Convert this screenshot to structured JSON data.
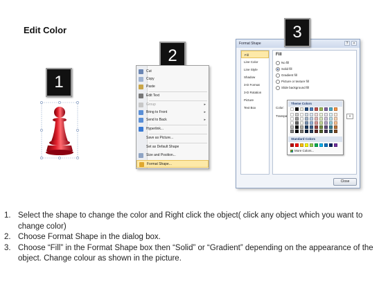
{
  "title": "Edit Color",
  "step_badges": [
    "1",
    "2",
    "3"
  ],
  "context_menu": {
    "items": [
      {
        "label": "Cut",
        "icon": "scissors-icon",
        "dim": false,
        "submenu": false
      },
      {
        "label": "Copy",
        "icon": "copy-icon",
        "dim": false,
        "submenu": false
      },
      {
        "label": "Paste",
        "icon": "paste-icon",
        "dim": false,
        "submenu": false
      },
      {
        "label": "Edit Text",
        "icon": "edit-text-icon",
        "dim": false,
        "submenu": false
      },
      {
        "label": "Group",
        "icon": "group-icon",
        "dim": true,
        "submenu": true
      },
      {
        "label": "Bring to Front",
        "icon": "bring-front-icon",
        "dim": false,
        "submenu": true
      },
      {
        "label": "Send to Back",
        "icon": "send-back-icon",
        "dim": false,
        "submenu": true
      },
      {
        "label": "Hyperlink...",
        "icon": "hyperlink-icon",
        "dim": false,
        "submenu": false
      },
      {
        "label": "Save as Picture...",
        "icon": "",
        "dim": false,
        "submenu": false
      },
      {
        "label": "Set as Default Shape",
        "icon": "",
        "dim": false,
        "submenu": false
      },
      {
        "label": "Size and Position...",
        "icon": "size-icon",
        "dim": false,
        "submenu": false
      },
      {
        "label": "Format Shape...",
        "icon": "format-shape-icon",
        "dim": false,
        "submenu": false,
        "highlighted": true
      }
    ]
  },
  "dialog": {
    "title": "Format Shape",
    "help": "?",
    "close_x": "×",
    "nav": [
      "Fill",
      "Line Color",
      "Line Style",
      "Shadow",
      "3-D Format",
      "3-D Rotation",
      "Picture",
      "Text Box"
    ],
    "fill_heading": "Fill",
    "options": [
      {
        "label": "No fill",
        "selected": false
      },
      {
        "label": "Solid fill",
        "selected": true
      },
      {
        "label": "Gradient fill",
        "selected": false
      },
      {
        "label": "Picture or texture fill",
        "selected": false
      },
      {
        "label": "Slide background fill",
        "selected": false
      }
    ],
    "color_label": "Color:",
    "transparency_label": "Transparency:",
    "close_button": "Close",
    "accent_color": "#c00000"
  },
  "palette": {
    "theme_heading": "Theme Colors",
    "standard_heading": "Standard Colors",
    "more_colors": "More Colors...",
    "theme_top": [
      "#ffffff",
      "#000000",
      "#eeece1",
      "#1f497d",
      "#4f81bd",
      "#c0504d",
      "#9bbb59",
      "#8064a2",
      "#4bacc6",
      "#f79646"
    ],
    "standard": [
      "#c00000",
      "#ff0000",
      "#ffc000",
      "#ffff00",
      "#92d050",
      "#00b050",
      "#00b0f0",
      "#0070c0",
      "#002060",
      "#7030a0"
    ]
  },
  "instructions": [
    {
      "num": "1.",
      "text": "Select the shape to change the color and Right click the object( click any object which you want to change color)"
    },
    {
      "num": "2.",
      "text": "Choose Format Shape in the dialog box."
    },
    {
      "num": "3.",
      "text": "Choose “Fill” in the Format Shape box then “Solid” or “Gradient” depending on the appearance of the object. Change colour as shown in the picture."
    }
  ]
}
